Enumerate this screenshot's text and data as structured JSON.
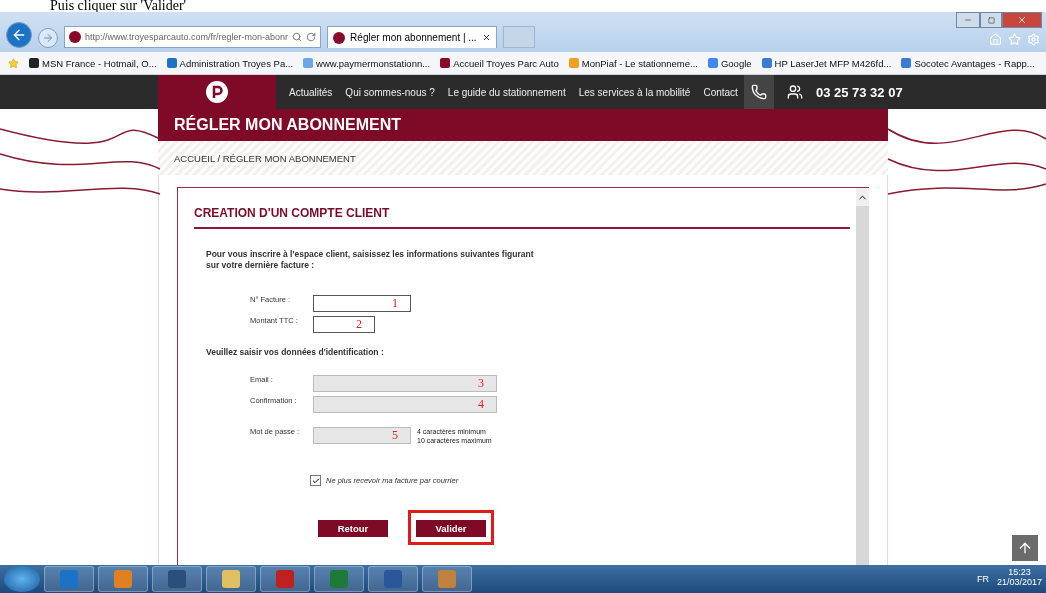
{
  "document_caption": "Puis cliquer sur 'Valider'",
  "browser": {
    "address": "http://www.troyesparcauto.com/fr/regler-mon-abonr",
    "tabs": [
      {
        "label": "Régler mon abonnement | ...",
        "selected": true
      }
    ],
    "favorites": [
      "MSN France - Hotmail, O...",
      "Administration  Troyes Pa...",
      "www.paymermonstationn...",
      "Accueil  Troyes Parc Auto",
      "MonPiaf - Le stationneme...",
      "Google",
      "HP LaserJet MFP M426fd...",
      "Socotec Avantages - Rapp..."
    ]
  },
  "site": {
    "nav": [
      "Actualités",
      "Qui sommes-nous ?",
      "Le guide du stationnement",
      "Les services à la mobilité",
      "Contact"
    ],
    "phone": "03 25 73 32 07",
    "page_title": "RÉGLER MON ABONNEMENT",
    "breadcrumb": "ACCUEIL / RÉGLER MON ABONNEMENT"
  },
  "form": {
    "title": "CREATION D'UN COMPTE CLIENT",
    "intro": "Pour vous inscrire à l'espace client, saisissez les informations suivantes figurant sur votre dernière facture :",
    "invoice_fields": [
      {
        "label": "N° Facture :",
        "value": "1",
        "disabled": false
      },
      {
        "label": "Montant TTC :",
        "value": "2",
        "disabled": false
      }
    ],
    "identity_heading": "Veuillez saisir vos données d'identification :",
    "identity_fields": [
      {
        "label": "Email :",
        "value": "3",
        "disabled": true
      },
      {
        "label": "Confirmation :",
        "value": "4",
        "disabled": true
      },
      {
        "label": "Mot de passe :",
        "value": "5",
        "disabled": true,
        "hint": [
          "4 caractères minimum",
          "10 caractères maximum"
        ]
      }
    ],
    "paper_opt_out": {
      "label": "Ne plus recevoir ma facture par courrier",
      "checked": true
    },
    "buttons": [
      {
        "label": "Retour",
        "highlighted": false
      },
      {
        "label": "Valider",
        "highlighted": true
      }
    ]
  },
  "taskbar": {
    "language": "FR",
    "time": "15:23",
    "date": "21/03/2017"
  }
}
